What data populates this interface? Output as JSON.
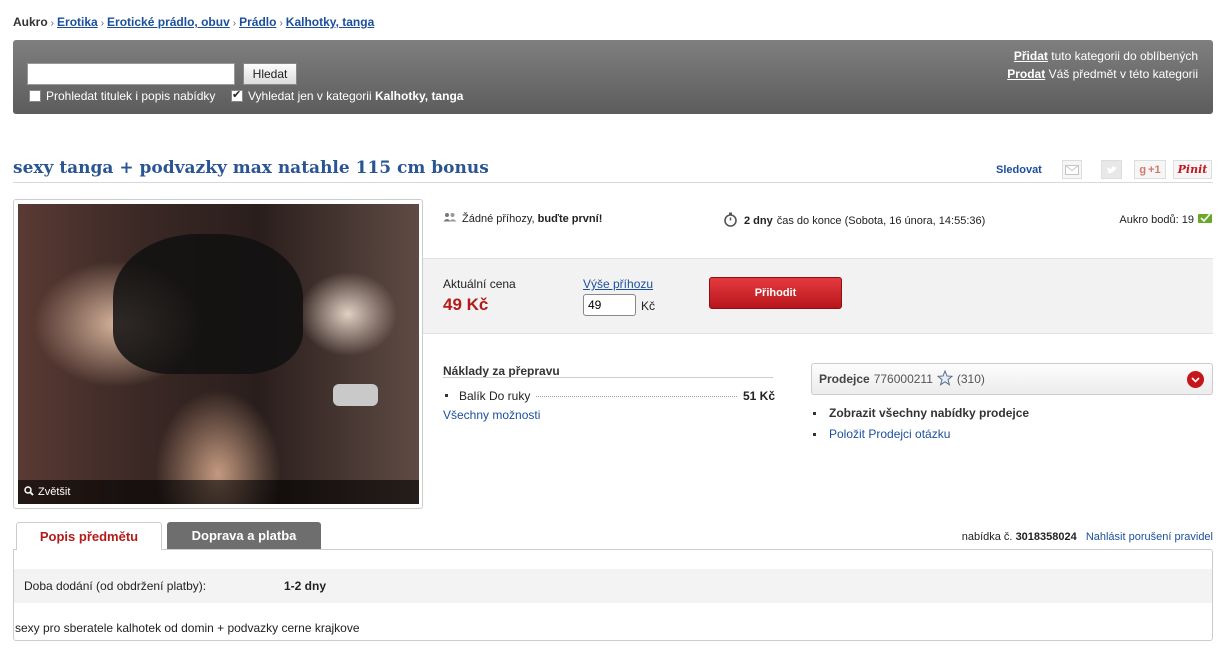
{
  "breadcrumb": {
    "root": "Aukro",
    "items": [
      "Erotika",
      "Erotické prádlo, obuv",
      "Prádlo",
      "Kalhotky, tanga"
    ],
    "separator": "›"
  },
  "search": {
    "input_value": "",
    "button_label": "Hledat",
    "option_title_desc": "Prohledat titulek i popis nabídky",
    "option_category_prefix": "Vyhledat jen v kategorii",
    "option_category_name": "Kalhotky, tanga",
    "right": {
      "add_link": "Přidat",
      "add_text": "tuto kategorii do oblíbených",
      "sell_link": "Prodat",
      "sell_text": "Váš předmět v této kategorii"
    }
  },
  "item": {
    "title": "sexy tanga + podvazky max natahle 115 cm bonus",
    "follow": "Sledovat",
    "share": {
      "gplus": "+1",
      "pinterest": "Pinit"
    },
    "photo_enlarge": "Zvětšit"
  },
  "info": {
    "bids_prefix": "Žádné příhozy,",
    "bids_cta": "buďte první!",
    "time_bold": "2 dny",
    "time_text": "čas do konce (Sobota, 16 února, 14:55:36)",
    "points_label": "Aukro bodů:",
    "points_value": "19"
  },
  "price": {
    "label": "Aktuální cena",
    "value": "49 Kč",
    "bid_label": "Výše příhozu",
    "bid_value": "49",
    "bid_currency": "Kč",
    "bid_button": "Přihodit"
  },
  "shipping": {
    "title": "Náklady za přepravu",
    "method": "Balík Do ruky",
    "price": "51 Kč",
    "all_options": "Všechny možnosti"
  },
  "seller": {
    "label": "Prodejce",
    "id": "776000211",
    "score": "(310)",
    "link_offers": "Zobrazit všechny nabídky prodejce",
    "link_question": "Položit Prodejci otázku"
  },
  "tabs": {
    "description": "Popis předmětu",
    "shipping_payment": "Doprava a platba"
  },
  "offer": {
    "label": "nabídka č.",
    "number": "3018358024",
    "report": "Nahlásit porušení pravidel"
  },
  "details": {
    "delivery_label": "Doba dodání (od obdržení platby):",
    "delivery_value": "1-2 dny",
    "description": "sexy pro sberatele kalhotek od domin + podvazky cerne krajkove"
  },
  "colors": {
    "accent_red": "#c5161c",
    "link_blue": "#1b4f9c",
    "title_blue": "#2a5592"
  }
}
